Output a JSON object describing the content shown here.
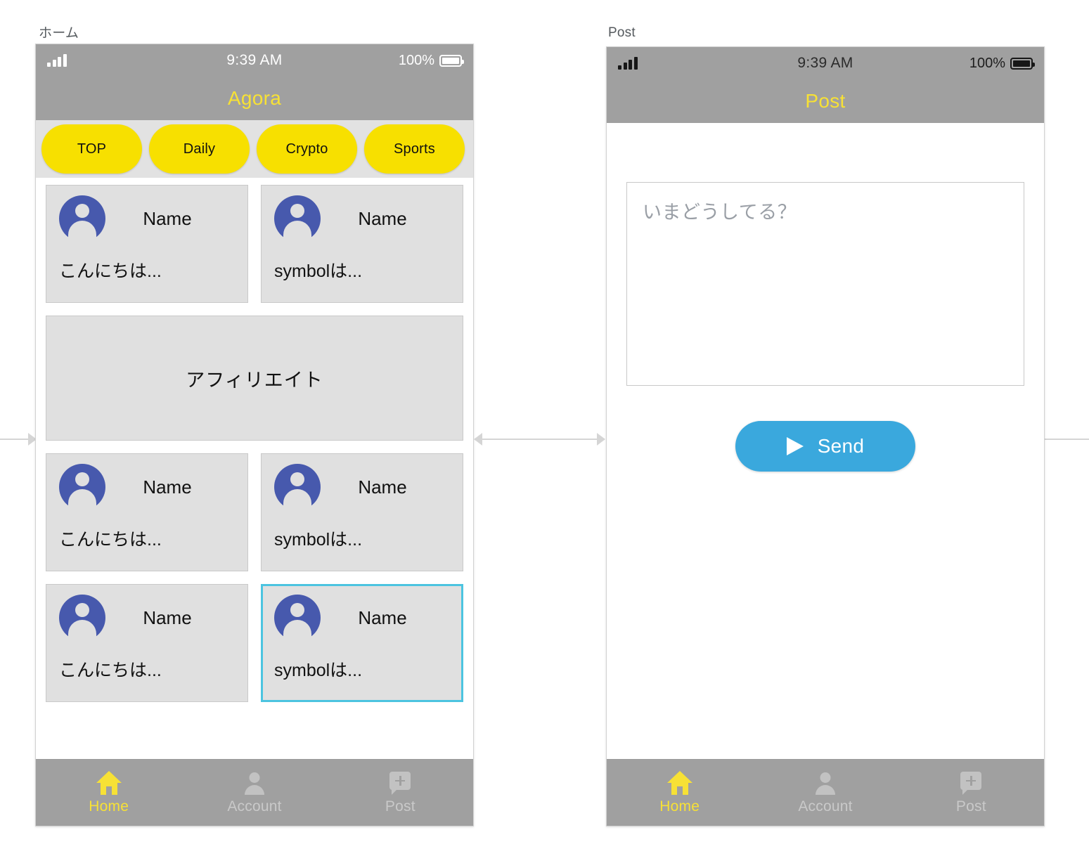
{
  "screens": [
    {
      "label": "ホーム",
      "status": {
        "time": "9:39 AM",
        "battery": "100%"
      },
      "header_title": "Agora",
      "tabs": [
        {
          "label": "TOP"
        },
        {
          "label": "Daily"
        },
        {
          "label": "Crypto"
        },
        {
          "label": "Sports"
        }
      ],
      "cards": [
        {
          "name": "Name",
          "body": "こんにちは...",
          "selected": false
        },
        {
          "name": "Name",
          "body": "symbolは...",
          "selected": false
        },
        {
          "name": "Name",
          "body": "こんにちは...",
          "selected": false
        },
        {
          "name": "Name",
          "body": "symbolは...",
          "selected": false
        },
        {
          "name": "Name",
          "body": "こんにちは...",
          "selected": false
        },
        {
          "name": "Name",
          "body": "symbolは...",
          "selected": true
        }
      ],
      "affiliate_label": "アフィリエイト",
      "bottom_nav": [
        {
          "label": "Home",
          "icon": "home-icon",
          "active": true
        },
        {
          "label": "Account",
          "icon": "account-icon",
          "active": false
        },
        {
          "label": "Post",
          "icon": "post-icon",
          "active": false
        }
      ]
    },
    {
      "label": "Post",
      "status": {
        "time": "9:39 AM",
        "battery": "100%"
      },
      "header_title": "Post",
      "composer": {
        "placeholder": "いまどうしてる？",
        "value": ""
      },
      "send_button": {
        "label": "Send",
        "icon": "send-icon"
      },
      "bottom_nav": [
        {
          "label": "Home",
          "icon": "home-icon",
          "active": true
        },
        {
          "label": "Account",
          "icon": "account-icon",
          "active": false
        },
        {
          "label": "Post",
          "icon": "post-icon",
          "active": false
        }
      ]
    }
  ],
  "colors": {
    "accent_yellow": "#f7e135",
    "tab_yellow": "#f7e000",
    "header_gray": "#a0a0a0",
    "card_gray": "#e0e0e0",
    "avatar_blue": "#4759ad",
    "selected_border": "#4cc4e0",
    "send_blue": "#3aa8dd",
    "connector_gray": "#d5d5d5"
  }
}
